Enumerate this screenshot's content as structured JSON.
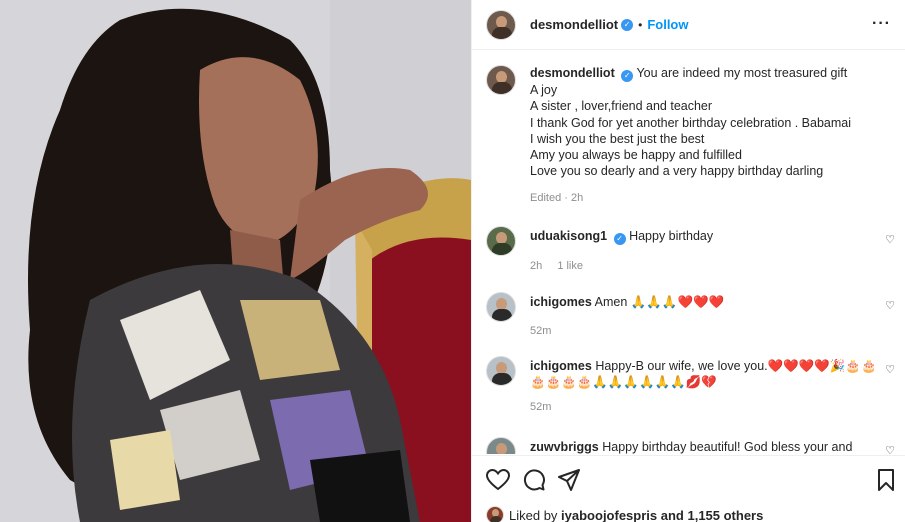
{
  "post": {
    "username": "desmondelliot",
    "follow_label": "Follow",
    "dot": "•",
    "more_label": "···"
  },
  "caption": {
    "username": "desmondelliot",
    "lines": [
      "You are indeed my most treasured gift",
      "A joy",
      "A sister , lover,friend and teacher",
      "I thank God for yet another birthday celebration . Babamai",
      "I wish you the best just the best",
      "Amy you always be happy and fulfilled",
      "Love you so dearly and a very happy birthday darling"
    ],
    "meta": "Edited · 2h"
  },
  "comments": [
    {
      "username": "uduakisong1",
      "verified": true,
      "text": "Happy birthday",
      "time": "2h",
      "likes": "1 like"
    },
    {
      "username": "ichigomes",
      "verified": false,
      "text": "Amen 🙏🙏🙏❤️❤️❤️",
      "time": "52m",
      "likes": ""
    },
    {
      "username": "ichigomes",
      "verified": false,
      "text": "Happy-B our wife, we love you.❤️❤️❤️❤️🎉🎂🎂🎂🎂🎂🎂🙏🙏🙏🙏🙏🙏💋💔",
      "time": "52m",
      "likes": ""
    },
    {
      "username": "zuwvbriggs",
      "verified": false,
      "text": "Happy birthday beautiful! God bless your and",
      "time": "",
      "likes": ""
    }
  ],
  "likes": {
    "prefix": "Liked by",
    "user": "iyaboojofespris",
    "suffix": "and 1,155 others"
  },
  "icons": [
    "heart-icon",
    "comment-icon",
    "share-icon",
    "bookmark-icon",
    "verified-icon",
    "more-icon"
  ],
  "colors": {
    "accent": "#0095f6",
    "verified": "#3897f0",
    "text": "#262626",
    "muted": "#8e8e8e"
  }
}
